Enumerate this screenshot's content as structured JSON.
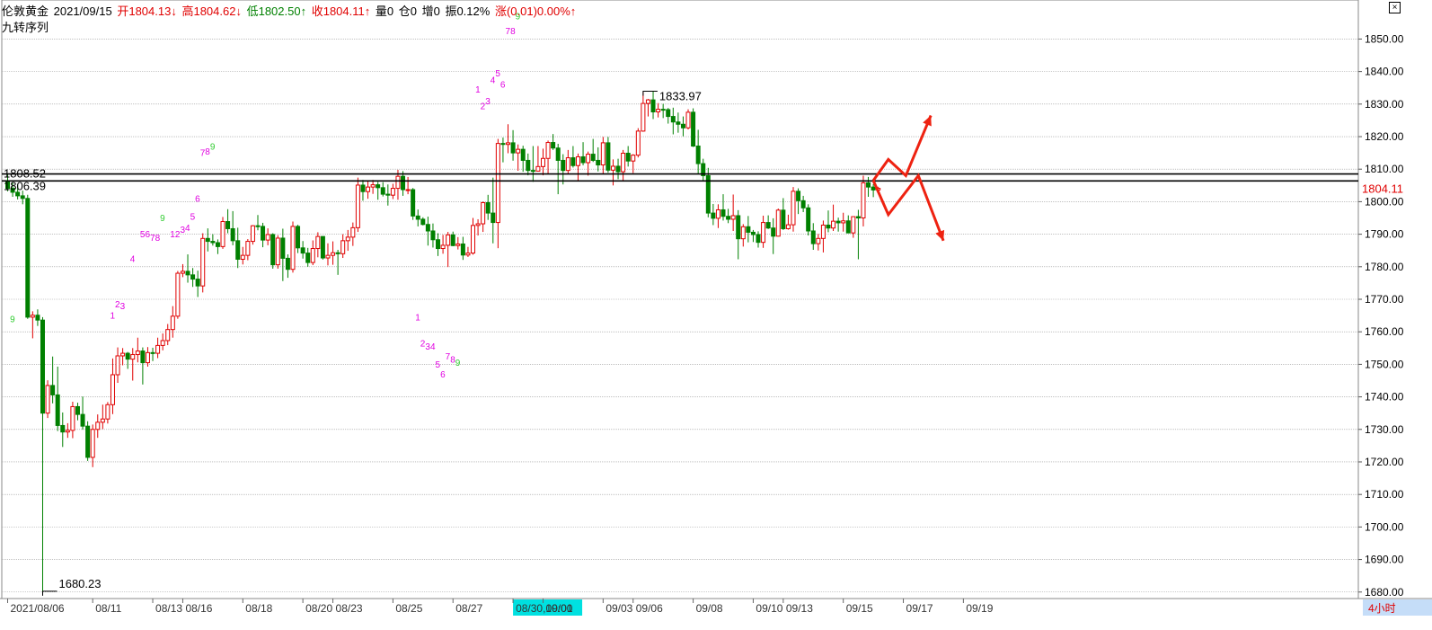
{
  "header": {
    "instrument": "伦敦黄金",
    "date": "2021/09/15",
    "open": "开1804.13↓",
    "high": "高1804.62↓",
    "low": "低1802.50↑",
    "close": "收1804.11↑",
    "volume": "量0",
    "position": "仓0",
    "increase": "增0",
    "amplitude": "振0.12%",
    "change": "涨(0.01)0.00%↑",
    "indicator": "九转序列",
    "close_icon": "close-icon"
  },
  "colors": {
    "up": "#e00000",
    "down": "#008000",
    "td_count": "#e000e0",
    "td_nine": "#33cc33",
    "arrow": "#ee2211",
    "period_bg": "#c5ddf8",
    "time_highlight": "#00e0e0"
  },
  "period_label": "4小时",
  "chart_data": {
    "type": "candlestick",
    "title": "伦敦黄金",
    "ylim": [
      1678,
      1862
    ],
    "y_ticks": [
      1680,
      1690,
      1700,
      1710,
      1720,
      1730,
      1740,
      1750,
      1760,
      1770,
      1780,
      1790,
      1800,
      1810,
      1820,
      1830,
      1840,
      1850
    ],
    "grid": true,
    "x_labels": [
      "2021/08/06",
      "08/11",
      "08/13",
      "08/16",
      "08/18",
      "08/20",
      "08/23",
      "08/25",
      "08/27",
      "08/30,10:00",
      "09/01",
      "09/03",
      "09/06",
      "09/08",
      "09/10",
      "09/13",
      "09/15",
      "09/17",
      "09/19"
    ],
    "x_label_index": [
      0,
      17,
      29,
      35,
      47,
      59,
      65,
      77,
      89,
      101,
      107,
      119,
      125,
      137,
      149,
      155,
      167,
      179,
      191
    ],
    "highlighted_x_label": "08/30,10:00",
    "candles": [
      [
        1806.4,
        1808.5,
        1803.2,
        1804.1
      ],
      [
        1804.1,
        1806.0,
        1801.5,
        1802.9
      ],
      [
        1802.9,
        1805.3,
        1800.7,
        1801.8
      ],
      [
        1801.8,
        1803.4,
        1799.2,
        1801.0
      ],
      [
        1801.0,
        1802.1,
        1764.0,
        1764.5
      ],
      [
        1764.5,
        1766.3,
        1758.0,
        1765.1
      ],
      [
        1765.1,
        1766.9,
        1761.8,
        1763.6
      ],
      [
        1763.6,
        1764.5,
        1680.2,
        1735.0
      ],
      [
        1735.0,
        1745.1,
        1733.5,
        1743.5
      ],
      [
        1743.5,
        1752.4,
        1738.0,
        1740.6
      ],
      [
        1740.6,
        1749.3,
        1729.5,
        1731.2
      ],
      [
        1731.2,
        1735.2,
        1724.6,
        1729.2
      ],
      [
        1729.2,
        1731.9,
        1727.4,
        1729.7
      ],
      [
        1729.7,
        1738.5,
        1727.3,
        1737.0
      ],
      [
        1737.0,
        1738.2,
        1732.8,
        1734.6
      ],
      [
        1734.6,
        1740.1,
        1729.9,
        1731.0
      ],
      [
        1731.0,
        1732.5,
        1720.3,
        1721.4
      ],
      [
        1721.4,
        1731.5,
        1718.4,
        1730.0
      ],
      [
        1730.0,
        1734.6,
        1727.4,
        1732.2
      ],
      [
        1732.2,
        1737.6,
        1730.1,
        1733.2
      ],
      [
        1733.2,
        1738.4,
        1731.8,
        1737.6
      ],
      [
        1737.6,
        1751.8,
        1734.7,
        1746.8
      ],
      [
        1746.8,
        1755.2,
        1744.3,
        1752.6
      ],
      [
        1752.6,
        1755.0,
        1749.7,
        1753.4
      ],
      [
        1753.4,
        1753.8,
        1748.6,
        1751.6
      ],
      [
        1751.6,
        1755.0,
        1745.0,
        1753.0
      ],
      [
        1753.0,
        1758.2,
        1750.6,
        1754.1
      ],
      [
        1754.1,
        1755.2,
        1743.8,
        1750.5
      ],
      [
        1750.5,
        1755.3,
        1749.3,
        1753.6
      ],
      [
        1753.6,
        1755.1,
        1751.0,
        1753.4
      ],
      [
        1753.4,
        1758.2,
        1751.9,
        1755.8
      ],
      [
        1755.8,
        1759.5,
        1754.3,
        1757.3
      ],
      [
        1757.3,
        1762.4,
        1755.9,
        1760.7
      ],
      [
        1760.7,
        1767.9,
        1758.2,
        1764.8
      ],
      [
        1764.8,
        1778.7,
        1764.0,
        1778.0
      ],
      [
        1778.0,
        1780.8,
        1776.8,
        1778.6
      ],
      [
        1778.6,
        1783.8,
        1775.1,
        1777.5
      ],
      [
        1777.5,
        1779.6,
        1773.8,
        1776.2
      ],
      [
        1776.2,
        1778.8,
        1770.7,
        1774.1
      ],
      [
        1774.1,
        1790.3,
        1772.1,
        1788.7
      ],
      [
        1788.7,
        1791.8,
        1784.7,
        1787.8
      ],
      [
        1787.8,
        1790.0,
        1786.5,
        1787.4
      ],
      [
        1787.4,
        1788.4,
        1783.9,
        1786.2
      ],
      [
        1786.2,
        1795.3,
        1785.5,
        1793.9
      ],
      [
        1793.9,
        1797.7,
        1790.3,
        1791.7
      ],
      [
        1791.7,
        1797.1,
        1786.6,
        1788.0
      ],
      [
        1788.0,
        1792.0,
        1779.6,
        1782.3
      ],
      [
        1782.3,
        1786.1,
        1780.7,
        1783.5
      ],
      [
        1783.5,
        1788.5,
        1782.0,
        1787.8
      ],
      [
        1787.8,
        1792.8,
        1786.8,
        1792.6
      ],
      [
        1792.6,
        1795.9,
        1791.2,
        1792.4
      ],
      [
        1792.4,
        1793.5,
        1786.0,
        1788.2
      ],
      [
        1788.2,
        1791.8,
        1786.6,
        1789.9
      ],
      [
        1789.9,
        1790.3,
        1779.4,
        1780.6
      ],
      [
        1780.6,
        1789.7,
        1779.4,
        1788.8
      ],
      [
        1788.8,
        1791.7,
        1775.6,
        1782.6
      ],
      [
        1782.6,
        1783.8,
        1776.6,
        1779.2
      ],
      [
        1779.2,
        1793.9,
        1778.2,
        1792.4
      ],
      [
        1792.4,
        1792.9,
        1784.2,
        1785.8
      ],
      [
        1785.8,
        1787.9,
        1782.5,
        1784.2
      ],
      [
        1784.2,
        1785.8,
        1780.0,
        1781.3
      ],
      [
        1781.3,
        1788.1,
        1780.5,
        1785.6
      ],
      [
        1785.6,
        1790.6,
        1782.9,
        1789.3
      ],
      [
        1789.3,
        1789.4,
        1782.2,
        1782.7
      ],
      [
        1782.7,
        1787.2,
        1780.4,
        1783.5
      ],
      [
        1783.5,
        1787.8,
        1780.6,
        1784.3
      ],
      [
        1784.3,
        1785.2,
        1777.5,
        1784.0
      ],
      [
        1784.0,
        1790.0,
        1782.7,
        1788.0
      ],
      [
        1788.0,
        1791.3,
        1784.9,
        1789.1
      ],
      [
        1789.1,
        1793.6,
        1786.4,
        1792.0
      ],
      [
        1792.0,
        1807.4,
        1790.7,
        1805.1
      ],
      [
        1805.1,
        1806.7,
        1800.3,
        1803.1
      ],
      [
        1803.1,
        1806.6,
        1800.9,
        1804.5
      ],
      [
        1804.5,
        1806.7,
        1802.4,
        1805.2
      ],
      [
        1805.2,
        1806.1,
        1800.6,
        1804.3
      ],
      [
        1804.3,
        1806.0,
        1801.6,
        1802.3
      ],
      [
        1802.3,
        1805.3,
        1798.8,
        1802.0
      ],
      [
        1802.0,
        1805.5,
        1800.8,
        1804.1
      ],
      [
        1804.1,
        1809.8,
        1800.6,
        1807.8
      ],
      [
        1807.8,
        1809.4,
        1801.8,
        1803.7
      ],
      [
        1803.7,
        1807.6,
        1802.3,
        1803.7
      ],
      [
        1803.7,
        1804.2,
        1794.4,
        1795.6
      ],
      [
        1795.6,
        1797.6,
        1792.4,
        1794.6
      ],
      [
        1794.6,
        1795.2,
        1792.7,
        1793.0
      ],
      [
        1793.0,
        1795.4,
        1786.5,
        1791.0
      ],
      [
        1791.0,
        1793.3,
        1785.9,
        1788.3
      ],
      [
        1788.3,
        1790.3,
        1783.3,
        1785.6
      ],
      [
        1785.6,
        1789.8,
        1784.0,
        1786.6
      ],
      [
        1786.6,
        1790.7,
        1779.9,
        1789.8
      ],
      [
        1789.8,
        1790.8,
        1786.3,
        1786.5
      ],
      [
        1786.5,
        1789.1,
        1785.3,
        1787.0
      ],
      [
        1787.0,
        1789.2,
        1782.1,
        1783.6
      ],
      [
        1783.6,
        1786.1,
        1783.0,
        1784.2
      ],
      [
        1784.2,
        1795.0,
        1783.7,
        1792.7
      ],
      [
        1792.7,
        1794.6,
        1789.6,
        1793.2
      ],
      [
        1793.2,
        1800.0,
        1790.7,
        1799.7
      ],
      [
        1799.7,
        1802.1,
        1794.4,
        1796.5
      ],
      [
        1796.5,
        1807.4,
        1787.2,
        1793.6
      ],
      [
        1793.6,
        1819.3,
        1785.7,
        1817.9
      ],
      [
        1817.9,
        1819.7,
        1812.1,
        1817.6
      ],
      [
        1817.6,
        1823.8,
        1814.9,
        1818.1
      ],
      [
        1818.1,
        1822.0,
        1812.6,
        1815.0
      ],
      [
        1815.0,
        1817.6,
        1809.5,
        1816.1
      ],
      [
        1816.1,
        1817.2,
        1809.2,
        1812.7
      ],
      [
        1812.7,
        1814.8,
        1808.1,
        1809.6
      ],
      [
        1809.6,
        1817.1,
        1806.1,
        1809.4
      ],
      [
        1809.4,
        1817.1,
        1809.4,
        1810.8
      ],
      [
        1810.8,
        1816.3,
        1808.1,
        1813.3
      ],
      [
        1813.3,
        1818.8,
        1808.5,
        1818.2
      ],
      [
        1818.2,
        1820.8,
        1815.9,
        1816.5
      ],
      [
        1816.5,
        1817.8,
        1802.3,
        1812.7
      ],
      [
        1812.7,
        1814.6,
        1805.3,
        1809.6
      ],
      [
        1809.6,
        1815.9,
        1808.4,
        1813.5
      ],
      [
        1813.5,
        1817.1,
        1810.5,
        1811.1
      ],
      [
        1811.1,
        1814.8,
        1806.5,
        1813.8
      ],
      [
        1813.8,
        1818.3,
        1811.2,
        1812.0
      ],
      [
        1812.0,
        1815.4,
        1808.0,
        1814.6
      ],
      [
        1814.6,
        1819.3,
        1812.2,
        1812.7
      ],
      [
        1812.7,
        1816.7,
        1809.3,
        1811.3
      ],
      [
        1811.3,
        1819.9,
        1808.4,
        1818.1
      ],
      [
        1818.1,
        1819.9,
        1808.9,
        1809.7
      ],
      [
        1809.7,
        1813.0,
        1805.0,
        1810.9
      ],
      [
        1810.9,
        1813.2,
        1806.9,
        1809.2
      ],
      [
        1809.2,
        1815.9,
        1806.6,
        1814.9
      ],
      [
        1814.9,
        1817.1,
        1810.8,
        1812.5
      ],
      [
        1812.5,
        1814.6,
        1808.8,
        1814.3
      ],
      [
        1814.3,
        1822.6,
        1813.6,
        1821.7
      ],
      [
        1821.7,
        1833.7,
        1821.5,
        1830.2
      ],
      [
        1830.2,
        1831.6,
        1826.2,
        1831.3
      ],
      [
        1831.3,
        1834.0,
        1825.4,
        1827.6
      ],
      [
        1827.6,
        1830.3,
        1825.9,
        1828.4
      ],
      [
        1828.4,
        1830.1,
        1825.7,
        1828.3
      ],
      [
        1828.3,
        1828.8,
        1824.0,
        1826.2
      ],
      [
        1826.2,
        1828.9,
        1820.7,
        1824.5
      ],
      [
        1824.5,
        1827.4,
        1821.2,
        1823.8
      ],
      [
        1823.8,
        1826.2,
        1820.1,
        1822.7
      ],
      [
        1822.7,
        1828.4,
        1822.2,
        1827.5
      ],
      [
        1827.5,
        1828.7,
        1816.8,
        1817.1
      ],
      [
        1817.1,
        1822.1,
        1808.6,
        1811.7
      ],
      [
        1811.7,
        1813.2,
        1806.3,
        1808.0
      ],
      [
        1808.0,
        1810.4,
        1795.2,
        1796.5
      ],
      [
        1796.5,
        1799.3,
        1792.8,
        1794.9
      ],
      [
        1794.9,
        1799.2,
        1791.9,
        1797.5
      ],
      [
        1797.5,
        1802.3,
        1794.2,
        1795.5
      ],
      [
        1795.5,
        1797.8,
        1793.4,
        1794.6
      ],
      [
        1794.6,
        1802.2,
        1791.0,
        1795.7
      ],
      [
        1795.7,
        1797.4,
        1782.3,
        1788.6
      ],
      [
        1788.6,
        1793.1,
        1786.2,
        1792.3
      ],
      [
        1792.3,
        1795.6,
        1787.5,
        1790.6
      ],
      [
        1790.6,
        1791.3,
        1787.6,
        1789.9
      ],
      [
        1789.9,
        1790.9,
        1785.9,
        1787.5
      ],
      [
        1787.5,
        1795.7,
        1785.8,
        1793.6
      ],
      [
        1793.6,
        1795.8,
        1791.6,
        1791.9
      ],
      [
        1791.9,
        1794.9,
        1783.9,
        1789.4
      ],
      [
        1789.4,
        1797.9,
        1789.3,
        1797.4
      ],
      [
        1797.4,
        1801.1,
        1791.3,
        1791.7
      ],
      [
        1791.7,
        1796.0,
        1791.4,
        1792.9
      ],
      [
        1792.9,
        1804.5,
        1790.8,
        1803.2
      ],
      [
        1803.2,
        1804.1,
        1796.2,
        1800.3
      ],
      [
        1800.3,
        1801.8,
        1796.8,
        1798.1
      ],
      [
        1798.1,
        1799.2,
        1789.6,
        1791.0
      ],
      [
        1791.0,
        1793.4,
        1785.2,
        1787.1
      ],
      [
        1787.1,
        1790.1,
        1785.0,
        1788.7
      ],
      [
        1788.7,
        1794.2,
        1784.4,
        1792.8
      ],
      [
        1792.8,
        1797.3,
        1790.6,
        1791.9
      ],
      [
        1791.9,
        1799.1,
        1791.0,
        1794.0
      ],
      [
        1794.0,
        1795.1,
        1790.8,
        1793.5
      ],
      [
        1793.5,
        1796.6,
        1790.8,
        1794.1
      ],
      [
        1794.1,
        1795.8,
        1791.2,
        1790.4
      ],
      [
        1790.4,
        1794.3,
        1788.9,
        1795.4
      ],
      [
        1795.4,
        1797.5,
        1782.3,
        1795.0
      ],
      [
        1795.0,
        1808.0,
        1792.4,
        1805.8
      ],
      [
        1805.8,
        1807.6,
        1801.5,
        1804.5
      ],
      [
        1804.5,
        1805.4,
        1801.4,
        1803.6
      ],
      [
        1803.6,
        1804.6,
        1802.5,
        1804.1
      ]
    ],
    "reference_lines": [
      {
        "value": 1806.39,
        "label": "1806.39"
      },
      {
        "value": 1808.52,
        "label": "1808.52"
      }
    ],
    "annotations": [
      {
        "label": "1833.97",
        "value": 1833.97,
        "index": 127
      },
      {
        "label": "1680.23",
        "value": 1680.23,
        "index": 7
      }
    ],
    "last_price": "1804.11",
    "td_labels": [
      {
        "t": "9",
        "i": 1,
        "v": 1763
      },
      {
        "t": "1",
        "i": 21,
        "v": 1764
      },
      {
        "t": "2",
        "i": 22,
        "v": 1767.5
      },
      {
        "t": "3",
        "i": 23,
        "v": 1767
      },
      {
        "t": "4",
        "i": 25,
        "v": 1781.5
      },
      {
        "t": "5",
        "i": 27,
        "v": 1789
      },
      {
        "t": "6",
        "i": 28,
        "v": 1789
      },
      {
        "t": "7",
        "i": 29,
        "v": 1788
      },
      {
        "t": "8",
        "i": 30,
        "v": 1788
      },
      {
        "t": "9",
        "i": 31,
        "v": 1794
      },
      {
        "t": "1",
        "i": 33,
        "v": 1789
      },
      {
        "t": "2",
        "i": 34,
        "v": 1789
      },
      {
        "t": "3",
        "i": 35,
        "v": 1790.5
      },
      {
        "t": "4",
        "i": 36,
        "v": 1791
      },
      {
        "t": "5",
        "i": 37,
        "v": 1794.5
      },
      {
        "t": "6",
        "i": 38,
        "v": 1800
      },
      {
        "t": "7",
        "i": 39,
        "v": 1814
      },
      {
        "t": "8",
        "i": 40,
        "v": 1814.5
      },
      {
        "t": "9",
        "i": 41,
        "v": 1816
      },
      {
        "t": "1",
        "i": 82,
        "v": 1763.5
      },
      {
        "t": "2",
        "i": 83,
        "v": 1755.5
      },
      {
        "t": "3",
        "i": 84,
        "v": 1754.5
      },
      {
        "t": "4",
        "i": 85,
        "v": 1754.5
      },
      {
        "t": "5",
        "i": 86,
        "v": 1749
      },
      {
        "t": "6",
        "i": 87,
        "v": 1746
      },
      {
        "t": "7",
        "i": 88,
        "v": 1751.5
      },
      {
        "t": "8",
        "i": 89,
        "v": 1750.5
      },
      {
        "t": "9",
        "i": 90,
        "v": 1749.5
      },
      {
        "t": "1",
        "i": 94,
        "v": 1833.5
      },
      {
        "t": "2",
        "i": 95,
        "v": 1828.5
      },
      {
        "t": "3",
        "i": 96,
        "v": 1830
      },
      {
        "t": "4",
        "i": 97,
        "v": 1836.5
      },
      {
        "t": "5",
        "i": 98,
        "v": 1838.5
      },
      {
        "t": "6",
        "i": 99,
        "v": 1835
      },
      {
        "t": "7",
        "i": 100,
        "v": 1851.5
      },
      {
        "t": "8",
        "i": 101,
        "v": 1851.5
      },
      {
        "t": "9",
        "i": 102,
        "v": 1856
      }
    ],
    "forecast_arrows": [
      {
        "points": [
          [
            173,
            1806.5
          ],
          [
            176,
            1813
          ],
          [
            179.5,
            1808
          ],
          [
            184.5,
            1826.5
          ]
        ]
      },
      {
        "points": [
          [
            173,
            1806.5
          ],
          [
            176,
            1796
          ],
          [
            182,
            1808
          ],
          [
            187,
            1788
          ]
        ]
      }
    ]
  }
}
